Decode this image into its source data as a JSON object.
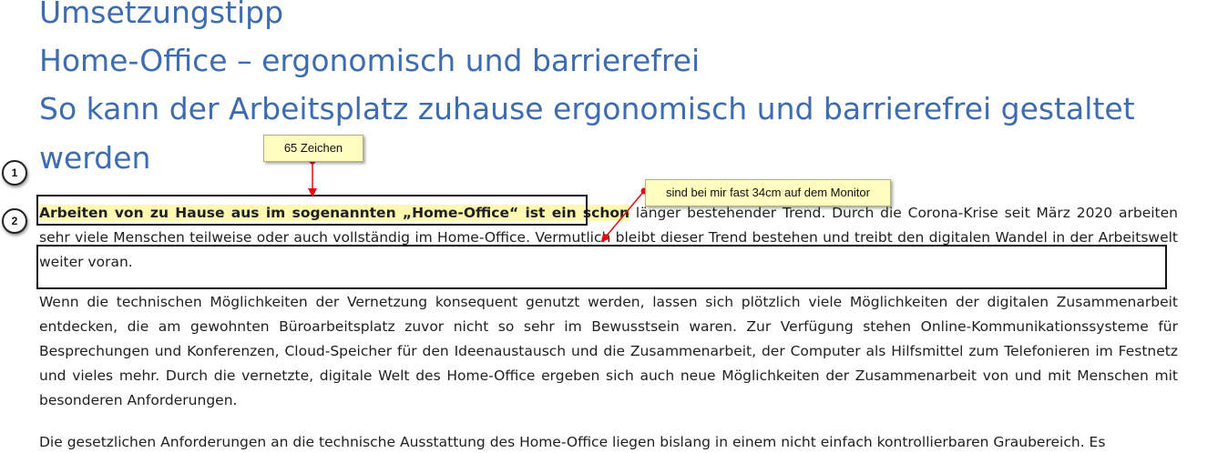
{
  "headings": {
    "tip": "Umsetzungstipp",
    "title": "Home-Office – ergonomisch und barrierefrei",
    "subtitle_line1": "So kann der Arbeitsplatz zuhause ergonomisch und barrierefrei gestaltet",
    "subtitle_line2": "werden"
  },
  "paragraphs": {
    "p1_highlighted": "Arbeiten von zu Hause aus im sogenannten „Home-Office“ ist ein schon",
    "p1_rest": " länger bestehender Trend. Durch die Corona-Krise seit März 2020 arbeiten sehr viele Menschen teilweise oder auch vollständig im Home-Office. Vermutlich bleibt dieser Trend bestehen und treibt den digitalen Wandel in der Arbeitswelt weiter voran.",
    "p2": "Wenn die technischen Möglichkeiten der Vernetzung konsequent genutzt werden, lassen sich plötzlich viele Möglichkeiten der digitalen Zusammenarbeit entdecken, die am gewohnten Büroarbeitsplatz zuvor nicht so sehr im Bewusstsein waren. Zur Verfügung stehen Online-Kommunikationssysteme für Besprechungen und Konferenzen, Cloud-Speicher für den Ideenaustausch und die Zusammenarbeit, der Computer als Hilfsmittel zum Telefonieren im Festnetz und vieles mehr. Durch die vernetzte, digitale Welt des Home-Office ergeben sich auch neue Möglichkeiten der Zusammenarbeit von und mit Menschen mit besonderen Anforderungen.",
    "p3": "Die gesetzlichen Anforderungen an die technische Ausstattung des Home-Office liegen bislang in einem nicht einfach kontrollierbaren Graubereich. Es"
  },
  "annotations": {
    "callout_chars": "65 Zeichen",
    "callout_width": "sind bei mir fast 34cm auf dem Monitor",
    "marker_1": "1",
    "marker_2": "2",
    "accent_color": "#3d6cb0",
    "highlight_color": "#fff9b0",
    "arrow_color": "#e01010"
  }
}
